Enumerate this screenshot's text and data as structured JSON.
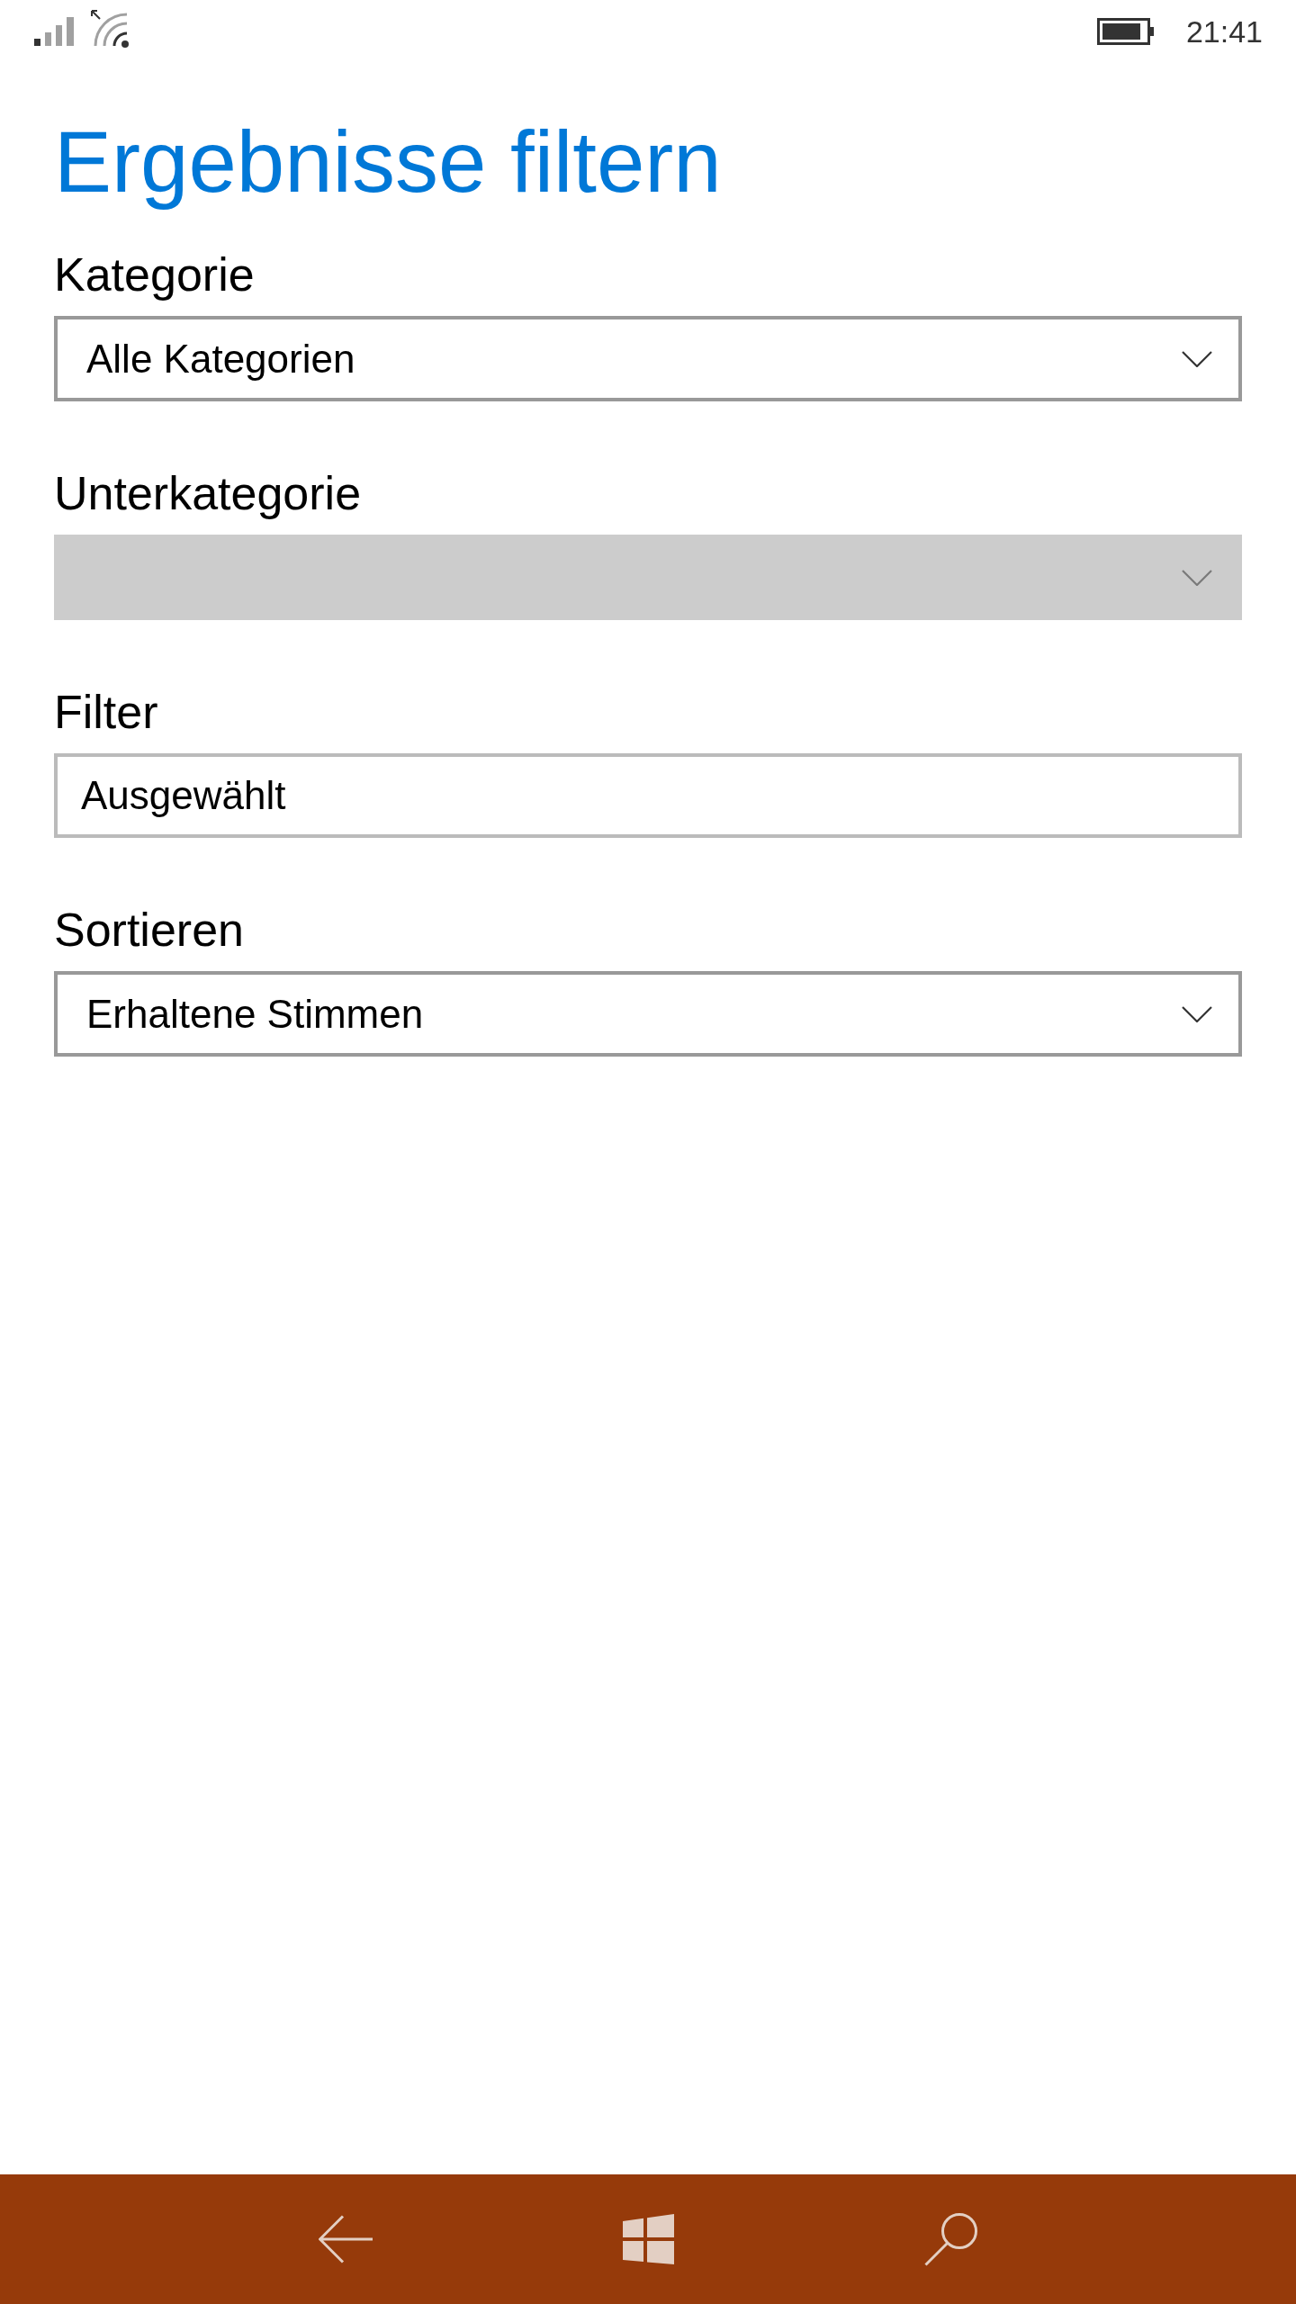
{
  "status_bar": {
    "time": "21:41"
  },
  "title": "Ergebnisse filtern",
  "fields": [
    {
      "kind": "dropdown",
      "label": "Kategorie",
      "value": "Alle Kategorien",
      "disabled": false
    },
    {
      "kind": "dropdown",
      "label": "Unterkategorie",
      "disabled": true
    },
    {
      "kind": "text",
      "label": "Filter",
      "value": "Ausgewählt",
      "disabled": false
    },
    {
      "kind": "dropdown",
      "label": "Sortieren",
      "value": "Erhaltene Stimmen",
      "disabled": false
    }
  ]
}
